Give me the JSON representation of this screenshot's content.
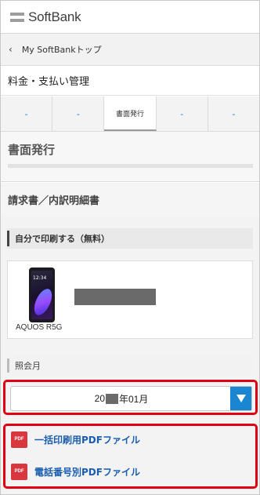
{
  "header": {
    "brand": "SoftBank"
  },
  "breadcrumb": {
    "label": "My SoftBankトップ"
  },
  "section": {
    "title": "料金・支払い管理"
  },
  "tabs": [
    {
      "label": "-",
      "active": false
    },
    {
      "label": "-",
      "active": false
    },
    {
      "label": "書面発行",
      "active": true
    },
    {
      "label": "-",
      "active": false
    },
    {
      "label": "-",
      "active": false
    }
  ],
  "page": {
    "heading": "書面発行"
  },
  "document": {
    "title": "請求書／内訳明細書"
  },
  "print_self": {
    "label": "自分で印刷する（無料）"
  },
  "device": {
    "name": "AQUOS R5G",
    "screen_time": "12:34"
  },
  "inquiry": {
    "label": "照会月"
  },
  "month_select": {
    "prefix": "20",
    "suffix": "年01月"
  },
  "pdf_links": [
    {
      "icon": "PDF",
      "label": "一括印刷用PDFファイル"
    },
    {
      "icon": "PDF",
      "label": "電話番号別PDFファイル"
    }
  ],
  "colors": {
    "highlight": "#e00012",
    "link": "#1a5dae",
    "select_arrow": "#1a86d2",
    "pdf_icon": "#d9373e",
    "tab_link": "#1a73c8"
  }
}
